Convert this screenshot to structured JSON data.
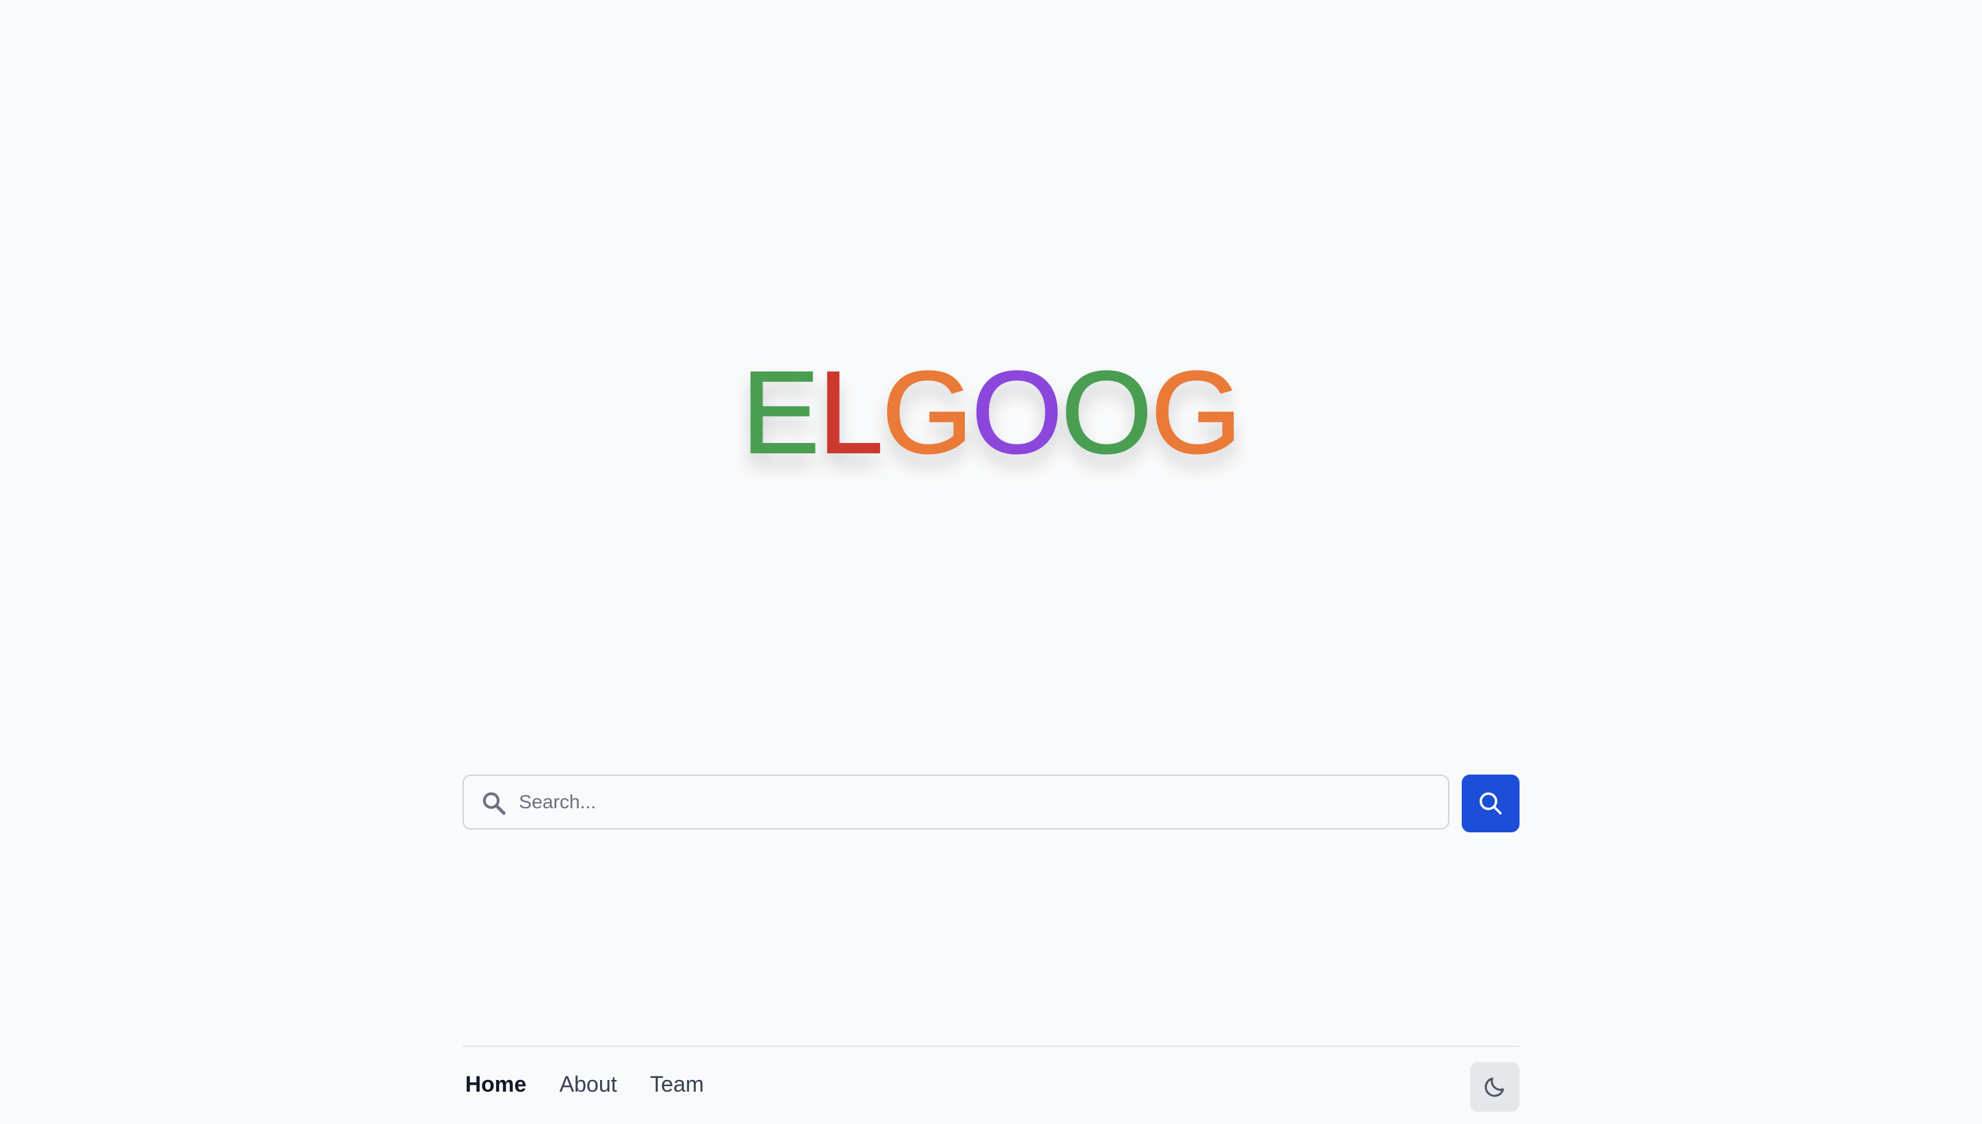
{
  "logo": {
    "letters": [
      {
        "char": "E",
        "color": "#4a9e52"
      },
      {
        "char": "L",
        "color": "#cc3a2f"
      },
      {
        "char": "G",
        "color": "#ea7a38"
      },
      {
        "char": "O",
        "color": "#8b46dc"
      },
      {
        "char": "O",
        "color": "#4a9e52"
      },
      {
        "char": "G",
        "color": "#ea7a38"
      }
    ]
  },
  "search": {
    "placeholder": "Search...",
    "value": "",
    "leading_icon": "search-icon",
    "button_icon": "search-icon",
    "button_color": "#1d4ed8"
  },
  "footer": {
    "nav": [
      {
        "label": "Home",
        "active": true
      },
      {
        "label": "About",
        "active": false
      },
      {
        "label": "Team",
        "active": false
      }
    ],
    "theme_toggle_icon": "moon-icon"
  }
}
